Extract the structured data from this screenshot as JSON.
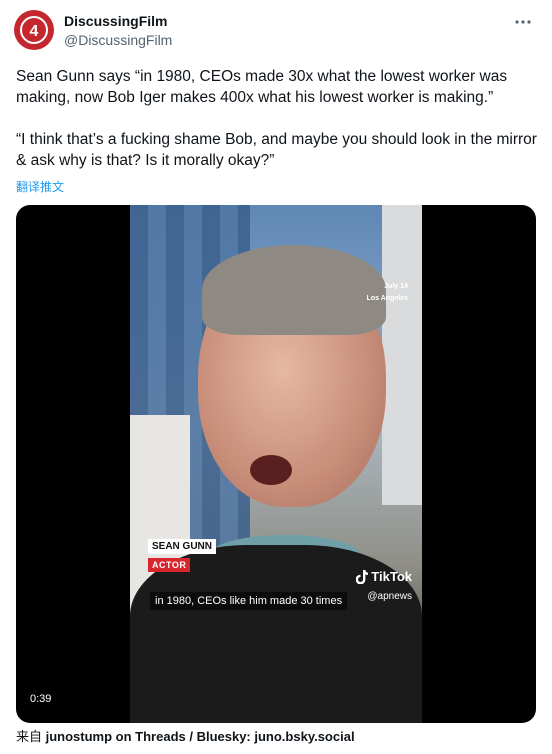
{
  "author": {
    "display_name": "DiscussingFilm",
    "handle": "@DiscussingFilm",
    "avatar_icon": "discussingfilm-logo-icon",
    "brand_color": "#c4272d"
  },
  "more_icon": "more-horizontal-icon",
  "tweet": {
    "paragraph_1": "Sean Gunn says “in 1980, CEOs made 30x what the lowest worker was making, now Bob Iger makes 400x what his lowest worker is making.”",
    "paragraph_2": "“I think that’s a fucking shame Bob, and maybe you should look in the mirror & ask why is that? Is it morally okay?”"
  },
  "translate_label": "翻译推文",
  "video": {
    "date_line": "July 14",
    "location_line": "Los Angeles",
    "name_tag": "SEAN GUNN",
    "role_tag": "ACTOR",
    "caption": "in 1980, CEOs like him made 30 times",
    "watermark": "TikTok",
    "watermark_handle": "@apnews",
    "duration": "0:39"
  },
  "source": {
    "prefix": "来自 ",
    "text": "junostump on Threads / Bluesky: juno.bsky.social"
  }
}
